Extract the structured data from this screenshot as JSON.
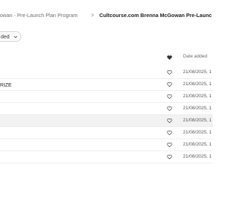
{
  "breadcrumb": {
    "previous": "Gowan - Pre-Launch Plan Program",
    "separator": ">",
    "current": "Cultcourse.com Brenna McGowan Pre-Launc"
  },
  "filter": {
    "label": "ded"
  },
  "table": {
    "headers": {
      "date_added": "Date added"
    },
    "rows": [
      {
        "title": "",
        "date": "21/08/2025, 1"
      },
      {
        "title": "RIZE",
        "date": "21/08/2025, 1"
      },
      {
        "title": "",
        "date": "21/08/2025, 1"
      },
      {
        "title": "",
        "date": "21/08/2025, 1"
      },
      {
        "title": "",
        "date": "21/08/2025, 1"
      },
      {
        "title": "",
        "date": "21/08/2025, 1"
      },
      {
        "title": "",
        "date": "21/08/2025, 1"
      },
      {
        "title": "",
        "date": "21/08/2025, 1"
      }
    ],
    "active_row": 4
  },
  "icons": {
    "favorite_header": "heart-filled-icon",
    "favorite_row": "heart-outline-icon",
    "filter_chevron": "chevron-down-icon"
  }
}
